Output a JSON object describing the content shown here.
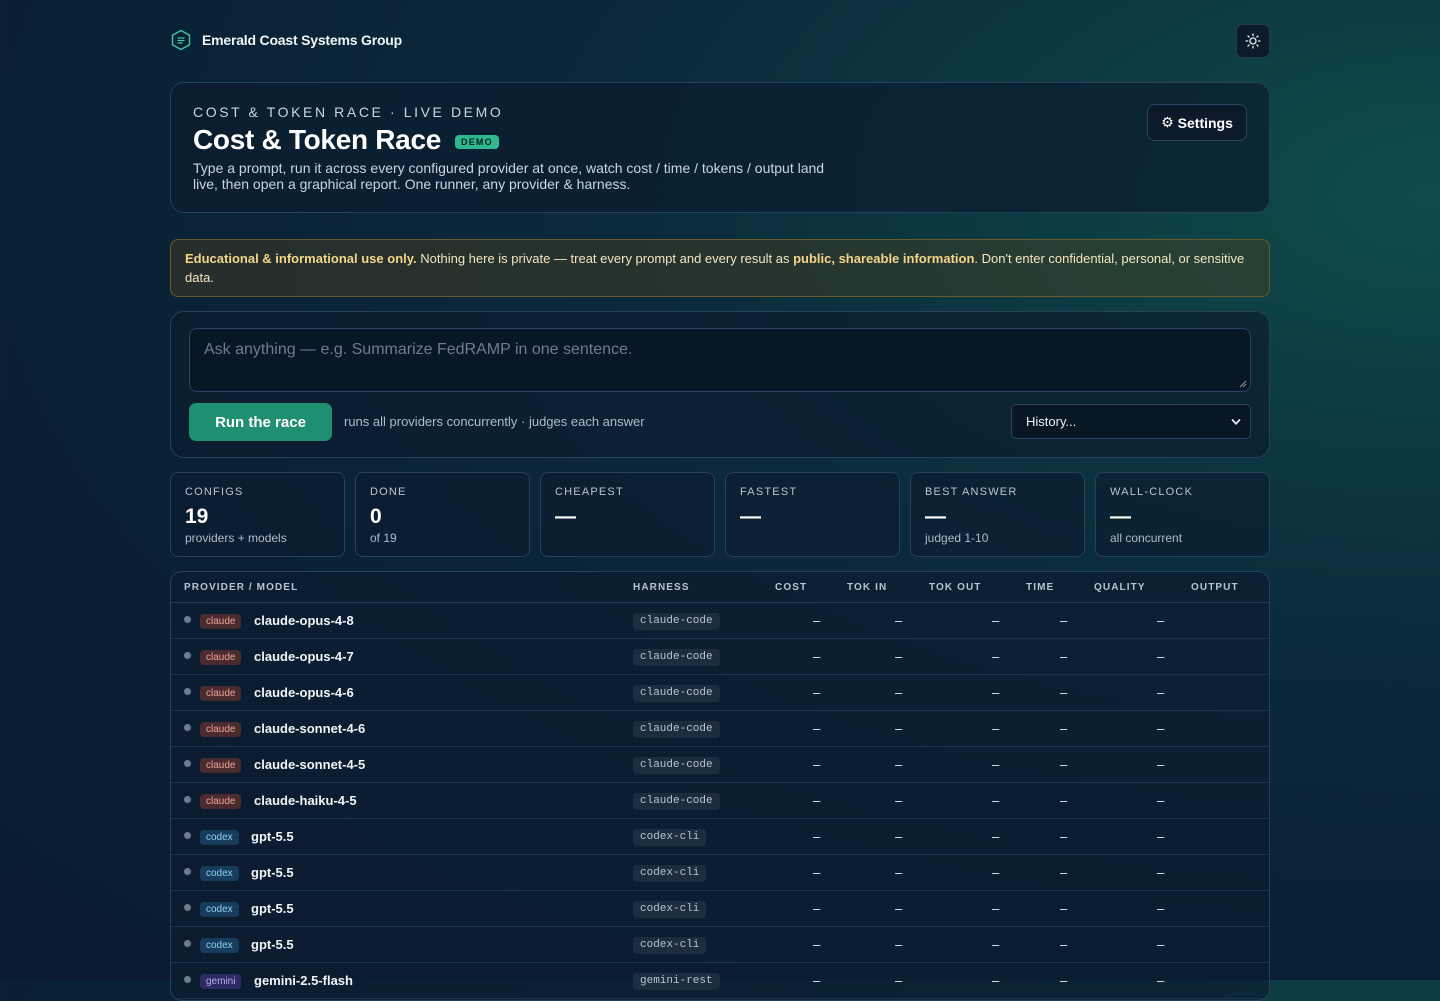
{
  "brand": {
    "name": "Emerald Coast Systems Group"
  },
  "hero": {
    "kicker": "COST & TOKEN RACE · LIVE DEMO",
    "title": "Cost & Token Race",
    "badge": "DEMO",
    "description": "Type a prompt, run it across every configured provider at once, watch cost / time / tokens / output land live, then open a graphical report. One runner, any provider & harness.",
    "settings_label": "Settings",
    "settings_icon": "gear-icon"
  },
  "notice": {
    "lead": "Educational & informational use only.",
    "text1": " Nothing here is private — treat every prompt and every result as ",
    "emph": "public, shareable information",
    "text2": ". Don't enter confidential, personal, or sensitive data."
  },
  "prompt": {
    "placeholder": "Ask anything — e.g. Summarize FedRAMP in one sentence.",
    "run_label": "Run the race",
    "hint": "runs all providers concurrently · judges each answer",
    "history_label": "History..."
  },
  "stats": [
    {
      "label": "CONFIGS",
      "value": "19",
      "sub": "providers + models"
    },
    {
      "label": "DONE",
      "value": "0",
      "sub": "of 19"
    },
    {
      "label": "CHEAPEST",
      "value": "—",
      "sub": ""
    },
    {
      "label": "FASTEST",
      "value": "—",
      "sub": ""
    },
    {
      "label": "BEST ANSWER",
      "value": "—",
      "sub": "judged 1-10"
    },
    {
      "label": "WALL-CLOCK",
      "value": "—",
      "sub": "all concurrent"
    }
  ],
  "table": {
    "columns": {
      "provider": "PROVIDER / MODEL",
      "harness": "HARNESS",
      "cost": "COST",
      "tok_in": "TOK IN",
      "tok_out": "TOK OUT",
      "time": "TIME",
      "quality": "QUALITY",
      "output": "OUTPUT"
    },
    "rows": [
      {
        "provider": "claude",
        "model": "claude-opus-4-8",
        "harness": "claude-code",
        "cost": "–",
        "tok_in": "–",
        "tok_out": "–",
        "time": "–",
        "quality": "–"
      },
      {
        "provider": "claude",
        "model": "claude-opus-4-7",
        "harness": "claude-code",
        "cost": "–",
        "tok_in": "–",
        "tok_out": "–",
        "time": "–",
        "quality": "–"
      },
      {
        "provider": "claude",
        "model": "claude-opus-4-6",
        "harness": "claude-code",
        "cost": "–",
        "tok_in": "–",
        "tok_out": "–",
        "time": "–",
        "quality": "–"
      },
      {
        "provider": "claude",
        "model": "claude-sonnet-4-6",
        "harness": "claude-code",
        "cost": "–",
        "tok_in": "–",
        "tok_out": "–",
        "time": "–",
        "quality": "–"
      },
      {
        "provider": "claude",
        "model": "claude-sonnet-4-5",
        "harness": "claude-code",
        "cost": "–",
        "tok_in": "–",
        "tok_out": "–",
        "time": "–",
        "quality": "–"
      },
      {
        "provider": "claude",
        "model": "claude-haiku-4-5",
        "harness": "claude-code",
        "cost": "–",
        "tok_in": "–",
        "tok_out": "–",
        "time": "–",
        "quality": "–"
      },
      {
        "provider": "codex",
        "model": "gpt-5.5",
        "harness": "codex-cli",
        "cost": "–",
        "tok_in": "–",
        "tok_out": "–",
        "time": "–",
        "quality": "–"
      },
      {
        "provider": "codex",
        "model": "gpt-5.5",
        "harness": "codex-cli",
        "cost": "–",
        "tok_in": "–",
        "tok_out": "–",
        "time": "–",
        "quality": "–"
      },
      {
        "provider": "codex",
        "model": "gpt-5.5",
        "harness": "codex-cli",
        "cost": "–",
        "tok_in": "–",
        "tok_out": "–",
        "time": "–",
        "quality": "–"
      },
      {
        "provider": "codex",
        "model": "gpt-5.5",
        "harness": "codex-cli",
        "cost": "–",
        "tok_in": "–",
        "tok_out": "–",
        "time": "–",
        "quality": "–"
      },
      {
        "provider": "gemini",
        "model": "gemini-2.5-flash",
        "harness": "gemini-rest",
        "cost": "–",
        "tok_in": "–",
        "tok_out": "–",
        "time": "–",
        "quality": "–"
      }
    ]
  },
  "colors": {
    "accent": "#1f8f72",
    "claude_badge": "#4a2b2e",
    "codex_badge": "#173d5c",
    "gemini_badge": "#2d2b62",
    "notice_border": "#6b5a2c"
  }
}
